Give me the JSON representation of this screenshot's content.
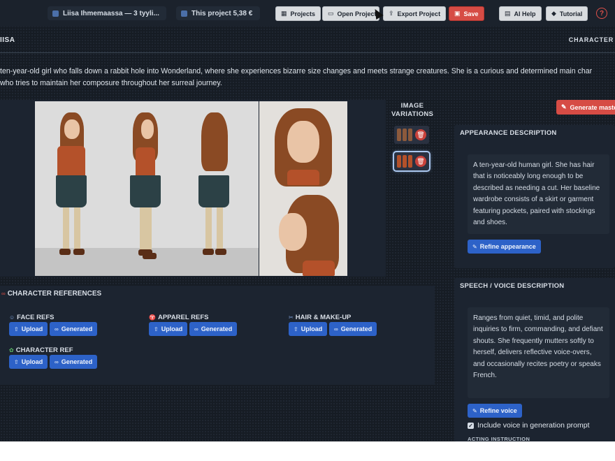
{
  "topbar": {
    "project_title": "Liisa Ihmemaassa — 3 tyyli...",
    "project_cost": "This project 5,38 €",
    "buttons": {
      "projects": "Projects",
      "open_project": "Open Project",
      "export_project": "Export Project",
      "save": "Save",
      "ai_help": "AI Help",
      "tutorial": "Tutorial"
    },
    "help_glyph": "?"
  },
  "header": {
    "character_name": "IISA",
    "section_label": "CHARACTER"
  },
  "description": {
    "line1": "ten-year-old girl who falls down a rabbit hole into Wonderland, where she experiences bizarre size changes and meets strange creatures. She is a curious and determined main char",
    "line2": "who tries to maintain her composure throughout her surreal journey."
  },
  "image_variations": {
    "title_line1": "IMAGE",
    "title_line2": "VARIATIONS",
    "delete_glyph": "🗑"
  },
  "generate_master": {
    "label": "Generate maste"
  },
  "appearance": {
    "title": "APPEARANCE DESCRIPTION",
    "text": "A ten-year-old human girl. She has hair that is noticeably long enough to be described as needing a cut. Her baseline wardrobe consists of a skirt or garment featuring pockets, paired with stockings and shoes.",
    "refine_label": "Refine appearance"
  },
  "speech": {
    "title": "SPEECH / VOICE DESCRIPTION",
    "text": "Ranges from quiet, timid, and polite inquiries to firm, commanding, and defiant shouts. She frequently mutters softly to herself, delivers reflective voice-overs, and occasionally recites poetry or speaks French.",
    "refine_label": "Refine voice",
    "include_voice_label": "Include voice in generation prompt",
    "include_voice_checked": true,
    "acting_instruction_label": "ACTING INSTRUCTION"
  },
  "references": {
    "title": "CHARACTER REFERENCES",
    "upload_label": "Upload",
    "generated_label": "Generated",
    "groups": [
      {
        "label": "FACE REFS"
      },
      {
        "label": "APPAREL REFS"
      },
      {
        "label": "HAIR & MAKE-UP"
      },
      {
        "label": "CHARACTER REF"
      }
    ]
  },
  "colors": {
    "accent_blue": "#2d62c8",
    "danger_red": "#d64c45",
    "panel": "#1c2430"
  },
  "icons": [
    "folder-icon",
    "grid-icon",
    "export-icon",
    "save-icon",
    "wand-icon",
    "hat-icon",
    "help-icon",
    "trash-icon",
    "upload-icon",
    "link-icon"
  ]
}
